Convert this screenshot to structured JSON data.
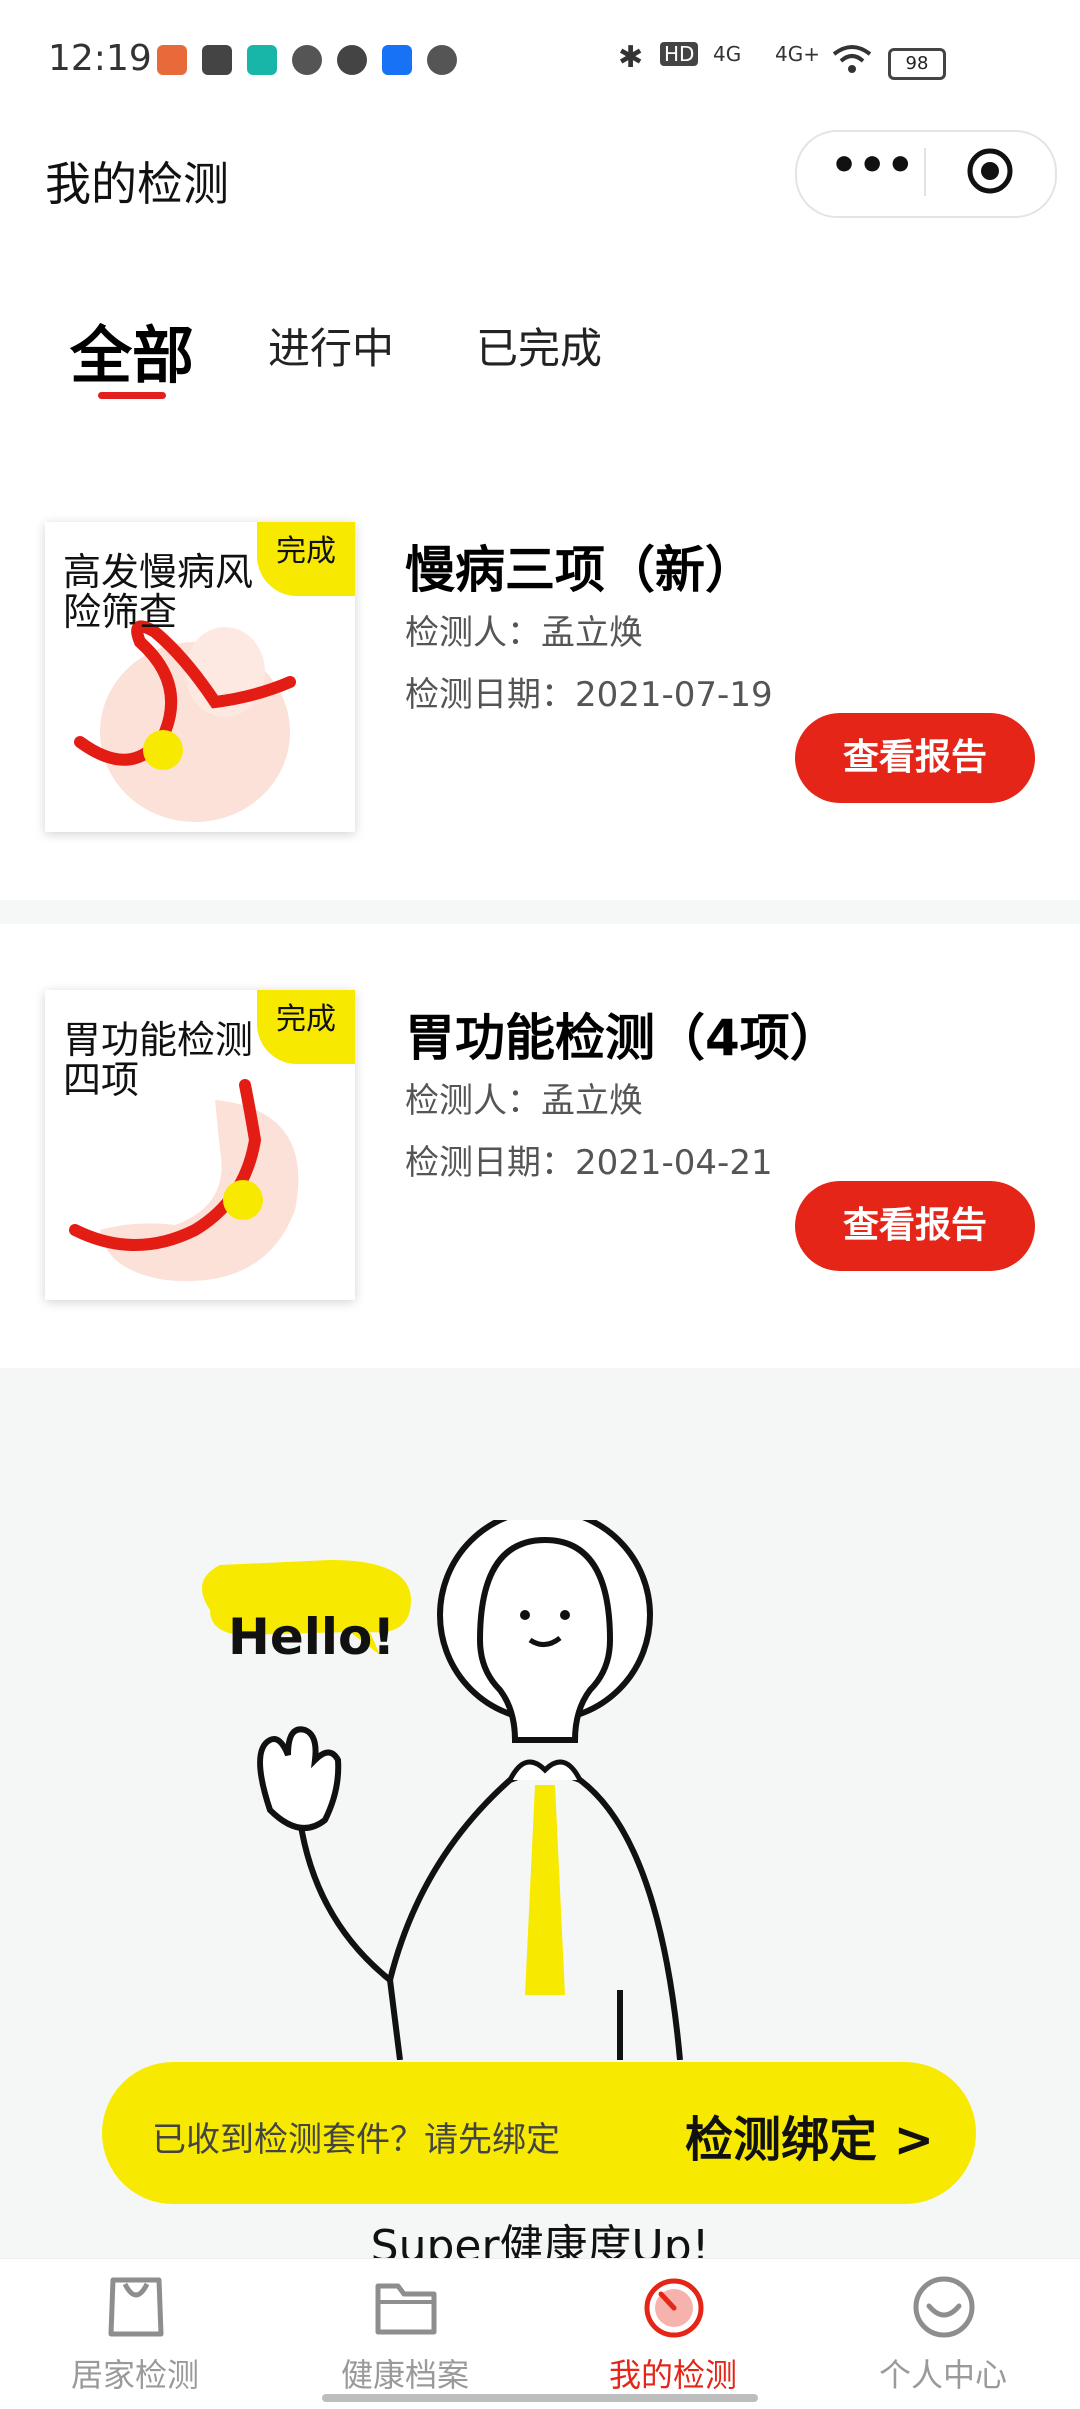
{
  "status_bar": {
    "time": "12:19",
    "network_labels": [
      "HD",
      "4G",
      "4G+"
    ],
    "battery": "98"
  },
  "header": {
    "title": "我的检测",
    "more_icon": "more-dots-icon",
    "target_icon": "target-icon"
  },
  "tabs": [
    {
      "label": "全部",
      "active": true
    },
    {
      "label": "进行中",
      "active": false
    },
    {
      "label": "已完成",
      "active": false
    }
  ],
  "tests": [
    {
      "thumb_text": "高发慢病风险筛查",
      "tag": "完成",
      "title": "慢病三项（新）",
      "tester": "检测人：孟立焕",
      "date": "检测日期：2021-07-19",
      "button": "查看报告"
    },
    {
      "thumb_text": "胃功能检测四项",
      "tag": "完成",
      "title": "胃功能检测（4项）",
      "tester": "检测人：孟立焕",
      "date": "检测日期：2021-04-21",
      "button": "查看报告"
    }
  ],
  "promo": {
    "bubble": "Hello!",
    "bind_hint": "已收到检测套件？请先绑定",
    "bind_action": "检测绑定 >",
    "tagline": "Super健康度Up!"
  },
  "bottom_nav": [
    {
      "label": "居家检测",
      "icon": "bag-icon",
      "active": false
    },
    {
      "label": "健康档案",
      "icon": "folder-icon",
      "active": false
    },
    {
      "label": "我的检测",
      "icon": "test-gauge-icon",
      "active": true
    },
    {
      "label": "个人中心",
      "icon": "smile-face-icon",
      "active": false
    }
  ],
  "colors": {
    "accent_red": "#e42517",
    "accent_yellow": "#f7ea00",
    "inactive_gray": "#9a9a9a"
  }
}
